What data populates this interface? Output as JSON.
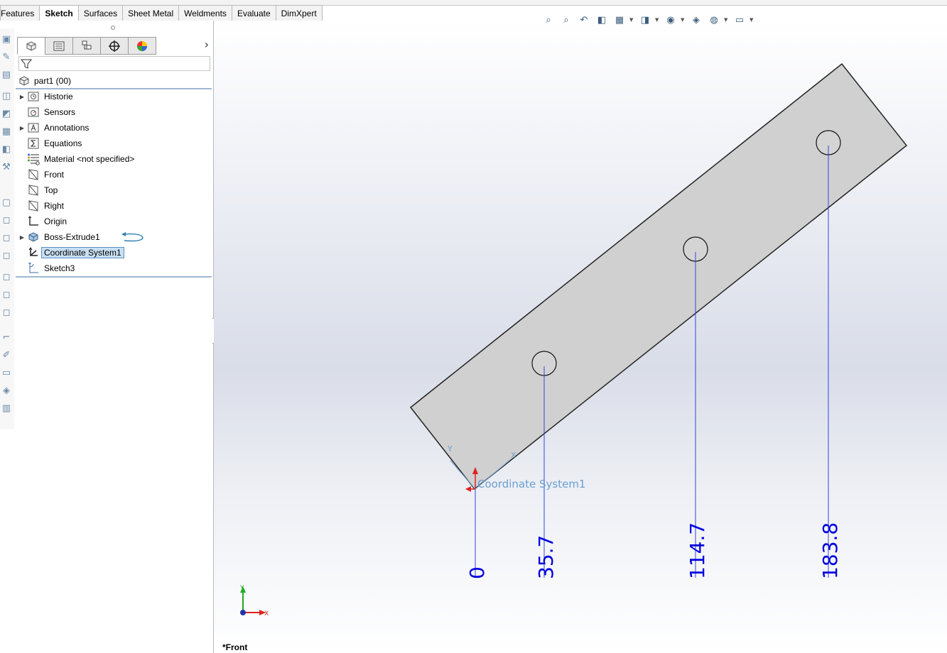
{
  "tabs": [
    {
      "label": "Features",
      "active": false
    },
    {
      "label": "Sketch",
      "active": true
    },
    {
      "label": "Surfaces",
      "active": false
    },
    {
      "label": "Sheet Metal",
      "active": false
    },
    {
      "label": "Weldments",
      "active": false
    },
    {
      "label": "Evaluate",
      "active": false
    },
    {
      "label": "DimXpert",
      "active": false
    }
  ],
  "tree": {
    "root_label": "part1  (00)",
    "items": [
      {
        "label": "Historie",
        "icon": "history-folder-icon",
        "expandable": true
      },
      {
        "label": "Sensors",
        "icon": "sensors-icon",
        "expandable": false
      },
      {
        "label": "Annotations",
        "icon": "annotations-icon",
        "expandable": true
      },
      {
        "label": "Equations",
        "icon": "equations-icon",
        "expandable": false
      },
      {
        "label": "Material <not specified>",
        "icon": "material-icon",
        "expandable": false
      },
      {
        "label": "Front",
        "icon": "plane-icon",
        "expandable": false
      },
      {
        "label": "Top",
        "icon": "plane-icon",
        "expandable": false
      },
      {
        "label": "Right",
        "icon": "plane-icon",
        "expandable": false
      },
      {
        "label": "Origin",
        "icon": "origin-icon",
        "expandable": false
      },
      {
        "label": "Boss-Extrude1",
        "icon": "extrude-icon",
        "expandable": true
      },
      {
        "label": "Coordinate System1",
        "icon": "coordinate-system-icon",
        "expandable": false,
        "selected": true
      },
      {
        "label": "Sketch3",
        "icon": "sketch-icon",
        "expandable": false
      }
    ]
  },
  "viewport": {
    "view_name": "*Front",
    "coord_label": "Coordinate System1",
    "axis_y": "Y",
    "axis_x": "X",
    "triad_x": "X",
    "triad_y": "Y",
    "dimensions": [
      "0",
      "35.7",
      "114.7",
      "183.8"
    ]
  },
  "colors": {
    "dimension": "#0000dd",
    "part_fill": "#d0d0d0",
    "selection": "#c8dff3",
    "coord_label": "#6aa0d0"
  }
}
